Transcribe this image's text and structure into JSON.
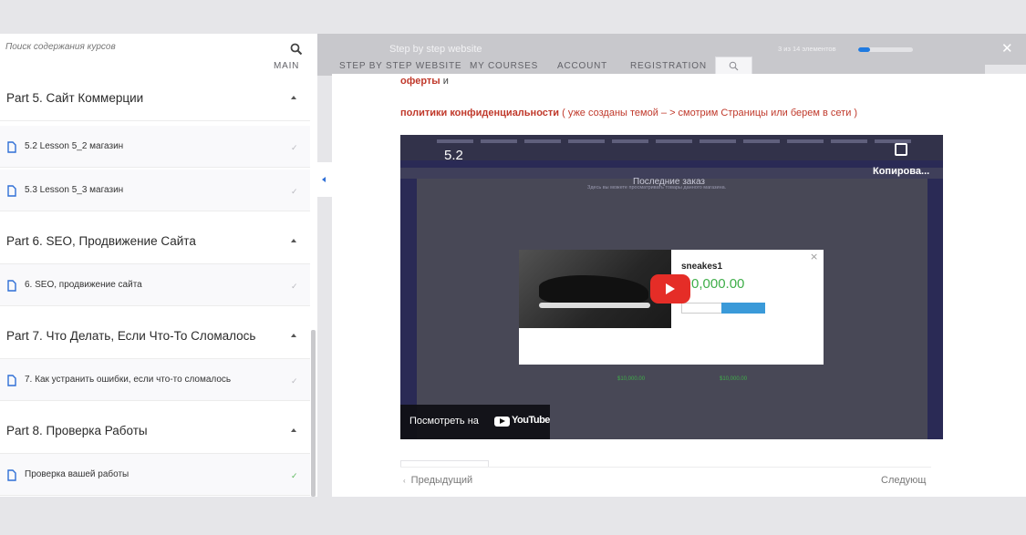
{
  "search": {
    "placeholder": "Поиск содержания курсов"
  },
  "header": {
    "course_title": "Step by step website",
    "progress_text": "3 из 14 элементов",
    "progress_fraction": 0.22
  },
  "nav": {
    "items": [
      "MAIN",
      "STEP BY STEP WEBSITE",
      "MY COURSES",
      "ACCOUNT",
      "REGISTRATION"
    ]
  },
  "sidebar": {
    "sections": [
      {
        "title": "Part 5. Сайт Коммерции",
        "lessons": [
          {
            "title": "5.2 Lesson 5_2 магазин",
            "completed": false
          },
          {
            "title": "5.3 Lesson 5_3 магазин",
            "completed": false
          }
        ]
      },
      {
        "title": "Part 6. SEO, Продвижение Сайта",
        "lessons": [
          {
            "title": "6. SEO, продвижение сайта",
            "completed": false
          }
        ]
      },
      {
        "title": "Part 7. Что Делать, Если Что-То Сломалось",
        "lessons": [
          {
            "title": "7. Как устранить ошибки, если что-то сломалось",
            "completed": false
          }
        ]
      },
      {
        "title": "Part 8. Проверка Работы",
        "lessons": [
          {
            "title": "Проверка вашей работы",
            "completed": true
          }
        ]
      }
    ]
  },
  "content": {
    "line1_bold": "оферты",
    "line1_rest": "и",
    "line2_bold": "политики конфиденциальности",
    "line2_rest": "( уже созданы темой – > смотрим Страницы или берем в сети )"
  },
  "video": {
    "counter": "5.2",
    "brand": "Копирова...",
    "page_title": "Последние заказ",
    "page_sub": "Здесь вы можете просматривать товары данного магазина.",
    "product_name": "sneakes1",
    "product_price": "0,000.00",
    "price_a": "$10,000.00",
    "price_b": "$10,000.00",
    "watch_label": "Посмотреть на",
    "youtube_text": "YouTube"
  },
  "footer": {
    "prev_label": "Предыдущий",
    "next_label": "Следующ"
  },
  "colors": {
    "accent": "#1f7ae0",
    "content_red": "#c0392b",
    "complete_green": "#5cb85c",
    "header_gray": "#c8c8cc"
  },
  "icons": {
    "search": "search-icon",
    "close": "close-icon",
    "lesson": "document-icon",
    "check": "check-icon",
    "caret": "caret-up-icon",
    "collapse": "chevron-left-icon"
  }
}
